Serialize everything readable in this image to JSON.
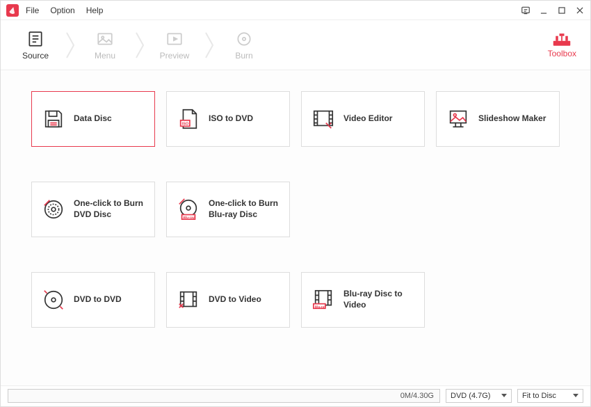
{
  "menu": {
    "file": "File",
    "option": "Option",
    "help": "Help"
  },
  "steps": {
    "source": "Source",
    "menu": "Menu",
    "preview": "Preview",
    "burn": "Burn"
  },
  "toolbox": {
    "label": "Toolbox"
  },
  "tools": {
    "data_disc": "Data Disc",
    "iso_to_dvd": "ISO to DVD",
    "video_editor": "Video Editor",
    "slideshow_maker": "Slideshow Maker",
    "oneclick_dvd": "One-click to Burn DVD Disc",
    "oneclick_bluray": "One-click to Burn Blu-ray Disc",
    "dvd_to_dvd": "DVD to DVD",
    "dvd_to_video": "DVD to Video",
    "bluray_to_video": "Blu-ray Disc to Video"
  },
  "status": {
    "capacity": "0M/4.30G",
    "disc_type": "DVD (4.7G)",
    "fit": "Fit to Disc"
  }
}
